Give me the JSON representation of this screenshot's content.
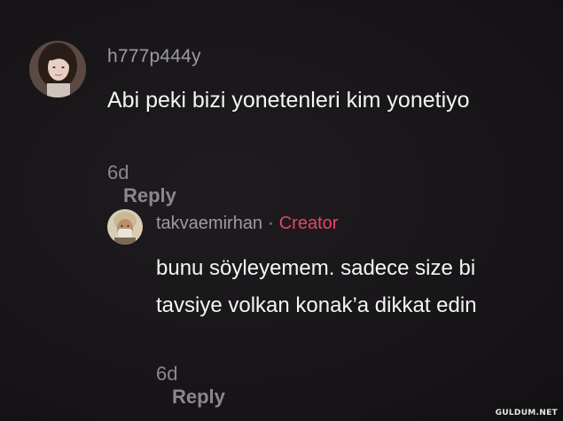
{
  "comments": [
    {
      "username": "h777p444y",
      "text": "Abi peki bizi yonetenleri kim yonetiyo",
      "time": "6d",
      "reply_label": "Reply"
    },
    {
      "username": "takvaemirhan",
      "separator": "·",
      "badge": "Creator",
      "text": "bunu söyleyemem. sadece size bi tavsiye volkan konak’a dikkat edin",
      "time": "6d",
      "reply_label": "Reply"
    }
  ],
  "watermark": "GULDUM.NET",
  "colors": {
    "background": "#181618",
    "text": "#f4f4f4",
    "muted": "#8a888a",
    "creator_badge": "#e8436a"
  }
}
